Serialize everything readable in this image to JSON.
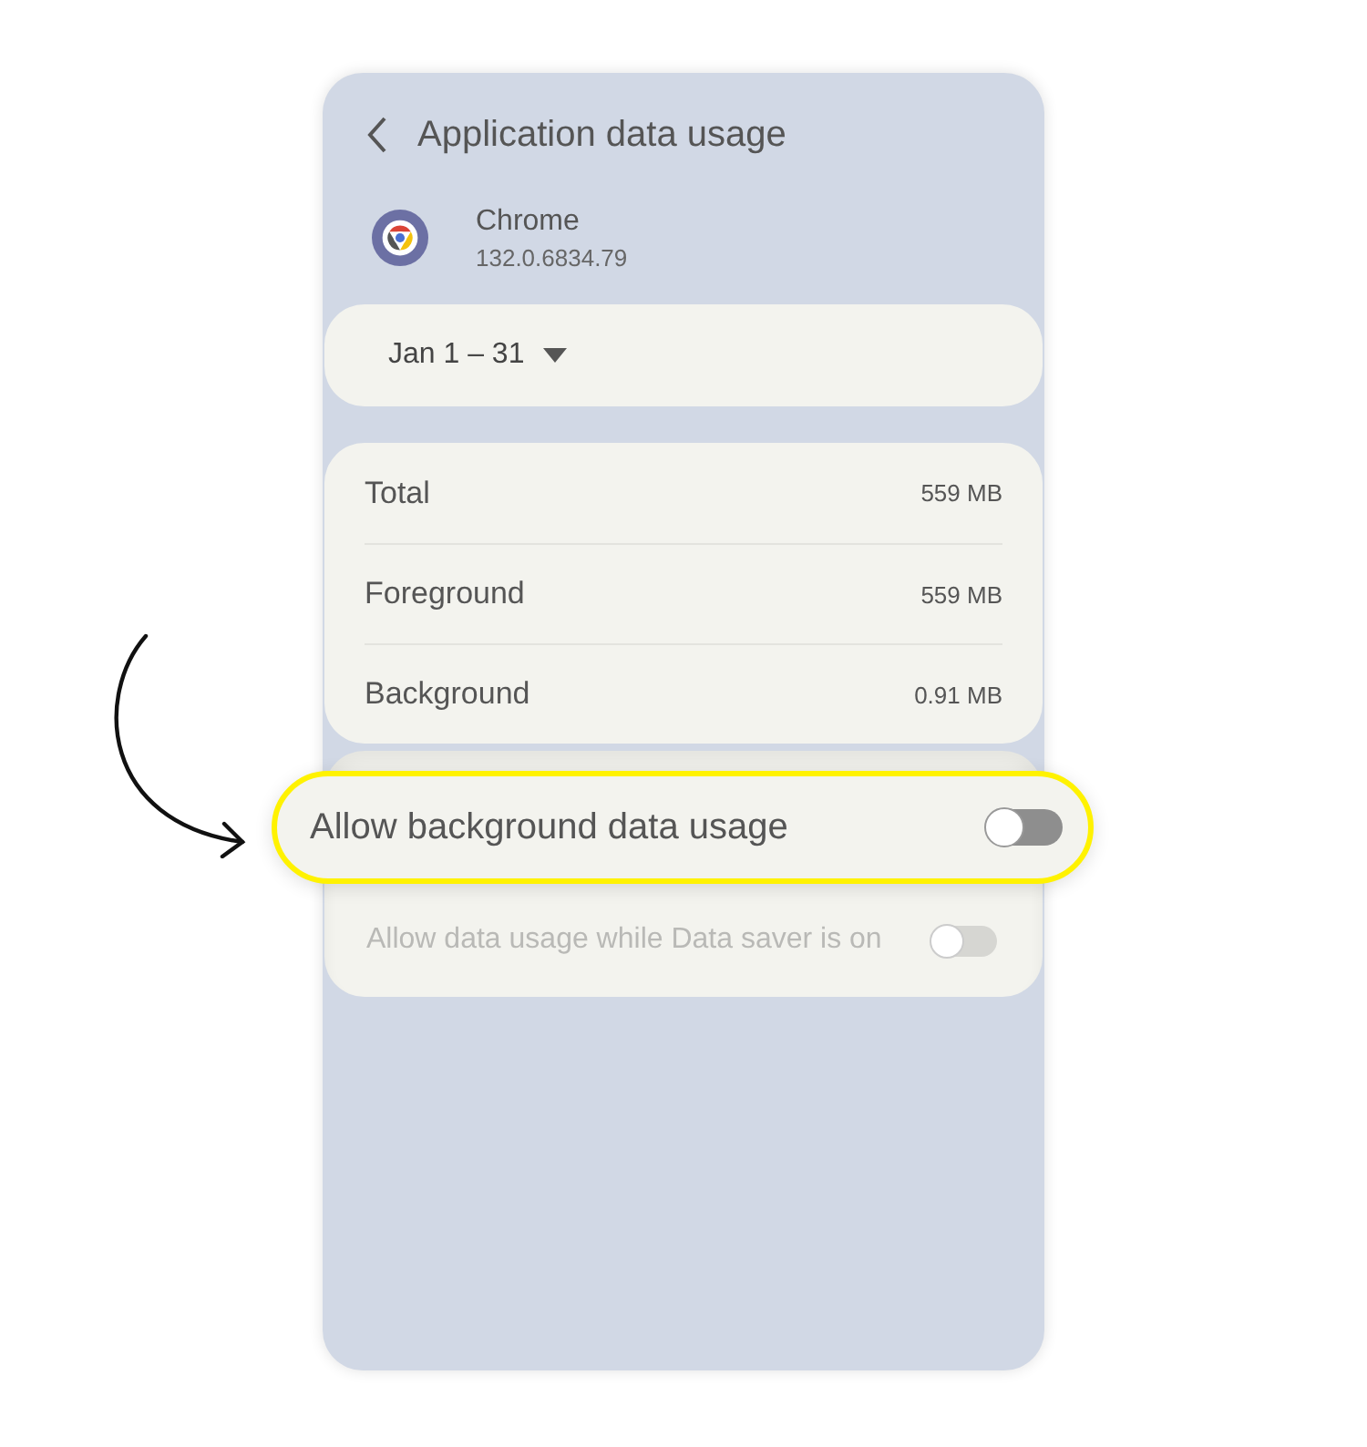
{
  "header": {
    "title": "Application data usage"
  },
  "app": {
    "name": "Chrome",
    "version": "132.0.6834.79"
  },
  "period": {
    "label": "Jan 1 – 31"
  },
  "usage": [
    {
      "label": "Total",
      "value": "559 MB"
    },
    {
      "label": "Foreground",
      "value": "559 MB"
    },
    {
      "label": "Background",
      "value": "0.91 MB"
    }
  ],
  "settings": [
    {
      "label": "Allow background data usage",
      "on": false,
      "disabled": false,
      "highlighted": true
    },
    {
      "label": "Allow data usage while Data saver is on",
      "on": false,
      "disabled": true,
      "highlighted": false
    }
  ]
}
